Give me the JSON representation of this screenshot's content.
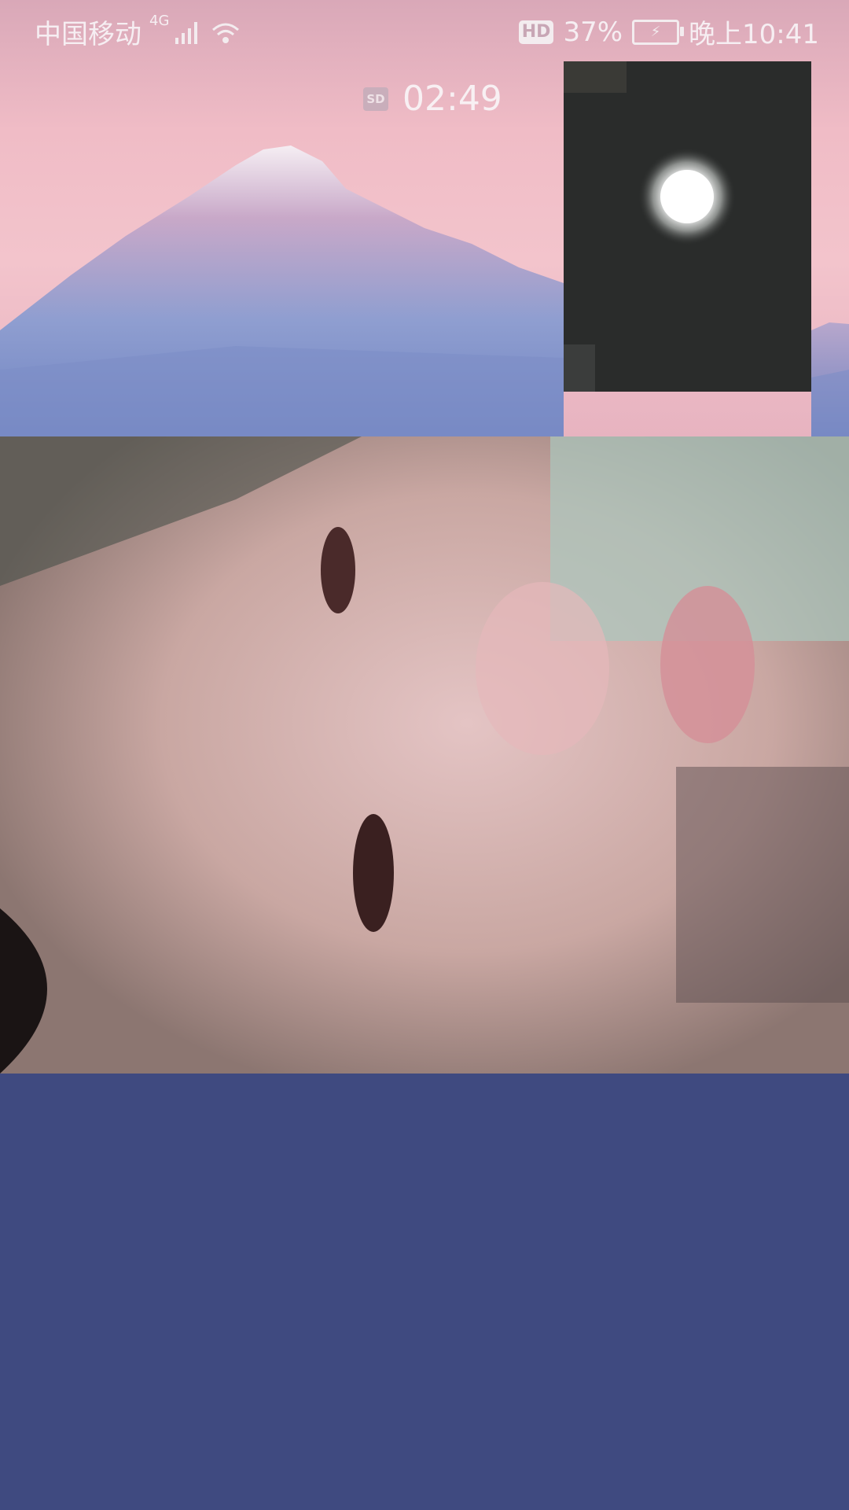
{
  "status_bar": {
    "carrier": "中国移动",
    "network_type": "4G",
    "hd_label": "HD",
    "battery_percent": "37%",
    "time": "晚上10:41"
  },
  "call": {
    "quality_badge": "SD",
    "duration": "02:49"
  },
  "colors": {
    "bottom_panel": "#3f4a80",
    "sky": "#f0bcc6",
    "mountain": "#7c8fc7"
  }
}
